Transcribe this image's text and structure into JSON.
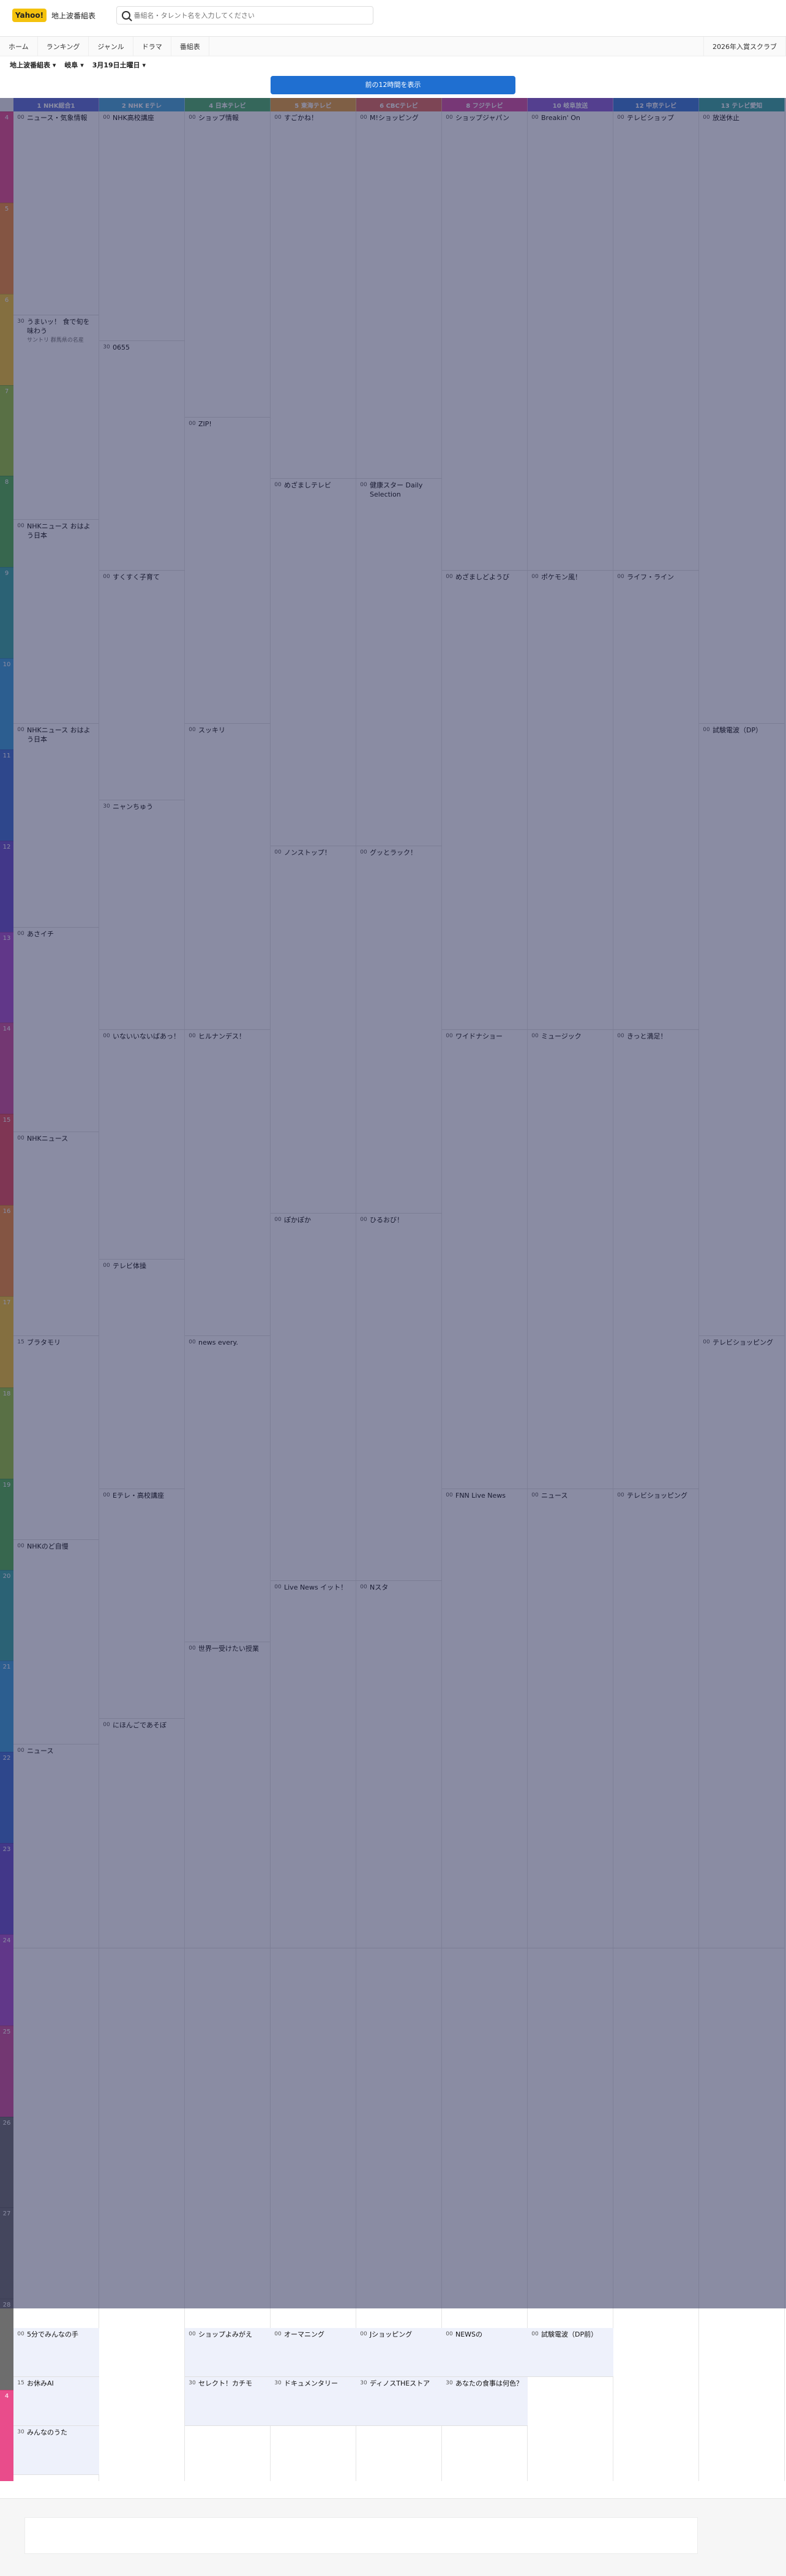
{
  "header": {
    "logo_mark": "Yahoo!",
    "logo_title": "地上波番組表",
    "search_placeholder": "番組名・タレント名を入力してください"
  },
  "nav": {
    "items": [
      "ホーム",
      "ランキング",
      "ジャンル",
      "ドラマ",
      "番組表"
    ],
    "right_item": "2026年入賞スクラブ"
  },
  "filters": [
    "地上波番組表 ▾",
    "岐阜 ▾",
    "3月19日土曜日 ▾"
  ],
  "banner": "前の12時間を表示",
  "hours": [
    "4",
    "5",
    "6",
    "7",
    "8",
    "9",
    "10",
    "11",
    "12",
    "13",
    "14",
    "15",
    "16",
    "17",
    "18",
    "19",
    "20",
    "21",
    "22",
    "23",
    "24",
    "25",
    "26",
    "27",
    "28",
    "4"
  ],
  "hour_colors": [
    "#e94c8b",
    "#f28c38",
    "#f2c230",
    "#9ac43b",
    "#52b14f",
    "#3aa8a0",
    "#3c9fd8",
    "#3f6fd0",
    "#6a4fc9",
    "#a94fc9",
    "#d04f9a",
    "#e94c5a",
    "#f28c38",
    "#f2c230",
    "#9ac43b",
    "#52b14f",
    "#3aa8a0",
    "#3c9fd8",
    "#3f6fd0",
    "#6a4fc9",
    "#a94fc9",
    "#d04f9a",
    "#6d6d6d",
    "#6d6d6d",
    "#6d6d6d",
    "#e94c8b"
  ],
  "channels": [
    {
      "name": "1 NHK総合1",
      "color": "#5f6fd6"
    },
    {
      "name": "2 NHK Eテレ",
      "color": "#47a7d8"
    },
    {
      "name": "4 日本テレビ",
      "color": "#4fb26a"
    },
    {
      "name": "5 東海テレビ",
      "color": "#e9a23b"
    },
    {
      "name": "6 CBCテレビ",
      "color": "#e46b5d"
    },
    {
      "name": "8 フジテレビ",
      "color": "#d84fa2"
    },
    {
      "name": "10 岐阜放送",
      "color": "#8f5fd6"
    },
    {
      "name": "12 中京テレビ",
      "color": "#3b7ad6"
    },
    {
      "name": "13 テレビ愛知",
      "color": "#3aa8a0"
    }
  ],
  "programs": [
    [
      {
        "min": "00",
        "title": "ニュース・気象情報",
        "desc": ""
      },
      {
        "min": "30",
        "title": "うまいッ！ 食で旬を味わう",
        "desc": "サントリ 群馬県の名産"
      },
      {
        "min": "00",
        "title": "NHKニュース おはよう日本",
        "desc": ""
      },
      {
        "min": "00",
        "title": "NHKニュース おはよう日本",
        "desc": ""
      },
      {
        "min": "00",
        "title": "あさイチ",
        "desc": ""
      },
      {
        "min": "00",
        "title": "NHKニュース",
        "desc": ""
      },
      {
        "min": "15",
        "title": "ブラタモリ",
        "desc": ""
      },
      {
        "min": "00",
        "title": "NHKのど自慢",
        "desc": ""
      },
      {
        "min": "00",
        "title": "ニュース",
        "desc": ""
      }
    ],
    [
      {
        "min": "00",
        "title": "NHK高校講座",
        "desc": ""
      },
      {
        "min": "30",
        "title": "0655",
        "desc": ""
      },
      {
        "min": "00",
        "title": "すくすく子育て",
        "desc": ""
      },
      {
        "min": "30",
        "title": "ニャンちゅう",
        "desc": ""
      },
      {
        "min": "00",
        "title": "いないいないばあっ！",
        "desc": ""
      },
      {
        "min": "00",
        "title": "テレビ体操",
        "desc": ""
      },
      {
        "min": "00",
        "title": "Eテレ・高校講座",
        "desc": ""
      },
      {
        "min": "00",
        "title": "にほんごであそぼ",
        "desc": ""
      }
    ],
    [
      {
        "min": "00",
        "title": "ショップ情報",
        "desc": ""
      },
      {
        "min": "00",
        "title": "ZIP!",
        "desc": ""
      },
      {
        "min": "00",
        "title": "スッキリ",
        "desc": ""
      },
      {
        "min": "00",
        "title": "ヒルナンデス！",
        "desc": ""
      },
      {
        "min": "00",
        "title": "news every.",
        "desc": ""
      },
      {
        "min": "00",
        "title": "世界一受けたい授業",
        "desc": ""
      }
    ],
    [
      {
        "min": "00",
        "title": "すごかね！",
        "desc": ""
      },
      {
        "min": "00",
        "title": "めざましテレビ",
        "desc": ""
      },
      {
        "min": "00",
        "title": "ノンストップ！",
        "desc": ""
      },
      {
        "min": "00",
        "title": "ぽかぽか",
        "desc": ""
      },
      {
        "min": "00",
        "title": "Live News イット！",
        "desc": ""
      }
    ],
    [
      {
        "min": "00",
        "title": "M!ショッピング",
        "desc": ""
      },
      {
        "min": "00",
        "title": "健康スター Daily Selection",
        "desc": ""
      },
      {
        "min": "00",
        "title": "グッとラック！",
        "desc": ""
      },
      {
        "min": "00",
        "title": "ひるおび！",
        "desc": ""
      },
      {
        "min": "00",
        "title": "Nスタ",
        "desc": ""
      }
    ],
    [
      {
        "min": "00",
        "title": "ショップジャパン",
        "desc": ""
      },
      {
        "min": "00",
        "title": "めざましどようび",
        "desc": ""
      },
      {
        "min": "00",
        "title": "ワイドナショー",
        "desc": ""
      },
      {
        "min": "00",
        "title": "FNN Live News",
        "desc": ""
      }
    ],
    [
      {
        "min": "00",
        "title": "Breakin' On",
        "desc": ""
      },
      {
        "min": "00",
        "title": "ポケモン風！",
        "desc": ""
      },
      {
        "min": "00",
        "title": "ミュージック",
        "desc": ""
      },
      {
        "min": "00",
        "title": "ニュース",
        "desc": ""
      }
    ],
    [
      {
        "min": "00",
        "title": "テレビショップ",
        "desc": ""
      },
      {
        "min": "00",
        "title": "ライフ・ライン",
        "desc": ""
      },
      {
        "min": "00",
        "title": "きっと満足！",
        "desc": ""
      },
      {
        "min": "00",
        "title": "テレビショッピング",
        "desc": ""
      }
    ],
    [
      {
        "min": "00",
        "title": "放送休止",
        "desc": ""
      },
      {
        "min": "00",
        "title": "試験電波（DP）",
        "desc": ""
      },
      {
        "min": "00",
        "title": "テレビショッピング",
        "desc": ""
      }
    ]
  ],
  "bottom_programs": [
    [
      {
        "min": "00",
        "title": "5分でみんなの手",
        "desc": ""
      },
      {
        "min": "15",
        "title": "お休みAI",
        "desc": ""
      },
      {
        "min": "30",
        "title": "みんなのうた",
        "desc": ""
      }
    ],
    [],
    [
      {
        "min": "00",
        "title": "ショップよみがえ",
        "desc": ""
      },
      {
        "min": "30",
        "title": "セレクト！カチモ",
        "desc": ""
      }
    ],
    [
      {
        "min": "00",
        "title": "オーマニング",
        "desc": ""
      },
      {
        "min": "30",
        "title": "ドキュメンタリー",
        "desc": ""
      }
    ],
    [
      {
        "min": "00",
        "title": "Jショッピング",
        "desc": ""
      },
      {
        "min": "30",
        "title": "ディノスTHEストア",
        "desc": ""
      }
    ],
    [
      {
        "min": "00",
        "title": "NEWSの",
        "desc": ""
      },
      {
        "min": "30",
        "title": "あなたの食事は何色？",
        "desc": ""
      }
    ],
    [
      {
        "min": "00",
        "title": "試験電波（DP前）",
        "desc": ""
      }
    ]
  ]
}
